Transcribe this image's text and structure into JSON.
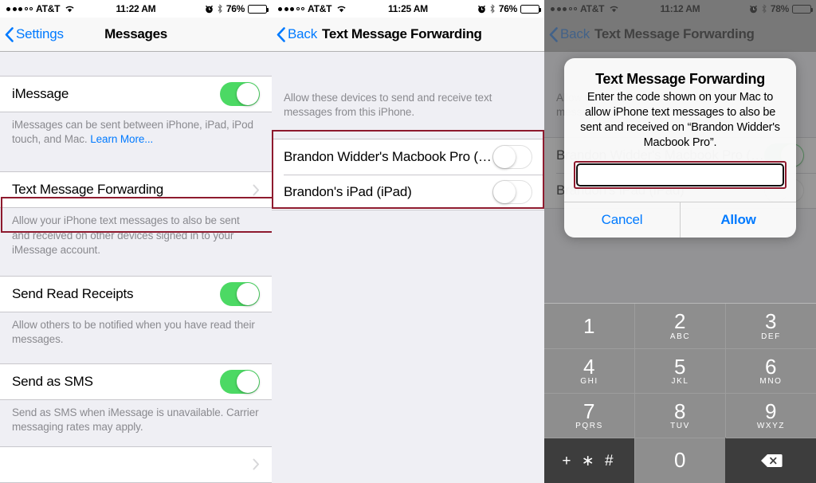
{
  "panels": [
    {
      "id": "messages-settings",
      "statusbar": {
        "carrier": "AT&T",
        "time": "11:22 AM",
        "battery_pct": "76%",
        "signal_filled": 3,
        "signal_hollow": 2,
        "icons": [
          "alarm-icon",
          "bluetooth-icon",
          "battery-icon",
          "wifi-icon"
        ]
      },
      "nav": {
        "back_label": "Settings",
        "title": "Messages"
      },
      "rows": [
        {
          "label": "iMessage",
          "type": "toggle",
          "state": "on"
        }
      ],
      "footnote_imessage": "iMessages can be sent between iPhone, iPad, iPod touch, and Mac. ",
      "footnote_link": "Learn More...",
      "forwarding_row": {
        "label": "Text Message Forwarding",
        "type": "disclosure"
      },
      "footnote_forwarding": "Allow your iPhone text messages to also be sent and received on other devices signed in to your iMessage account.",
      "read_receipts_row": {
        "label": "Send Read Receipts",
        "type": "toggle",
        "state": "on"
      },
      "footnote_read_receipts": "Allow others to be notified when you have read their messages.",
      "send_sms_row": {
        "label": "Send as SMS",
        "type": "toggle",
        "state": "on"
      },
      "footnote_send_sms": "Send as SMS when iMessage is unavailable. Carrier messaging rates may apply."
    },
    {
      "id": "forwarding-devices",
      "statusbar": {
        "carrier": "AT&T",
        "time": "11:25 AM",
        "battery_pct": "76%",
        "signal_filled": 3,
        "signal_hollow": 2
      },
      "nav": {
        "back_label": "Back",
        "title": "Text Message Forwarding"
      },
      "footnote_top": "Allow these devices to send and receive text messages from this iPhone.",
      "devices": [
        {
          "label": "Brandon Widder's Macbook Pro (…",
          "state": "off"
        },
        {
          "label": "Brandon's iPad (iPad)",
          "state": "off"
        }
      ]
    },
    {
      "id": "forwarding-code-dialog",
      "statusbar": {
        "carrier": "AT&T",
        "time": "11:12 AM",
        "battery_pct": "78%",
        "signal_filled": 3,
        "signal_hollow": 2
      },
      "nav": {
        "back_label": "Back",
        "title": "Text Message Forwarding"
      },
      "bg_footnote": "Allow these devices to send and receive text messages from this iPhone.",
      "bg_devices": [
        {
          "label": "Brandon Widder's Macbook Pro (…",
          "state": "on"
        },
        {
          "label": "Brandon's iPad (iPad)",
          "state": "off"
        }
      ],
      "alert": {
        "title": "Text Message Forwarding",
        "message": "Enter the code shown on your Mac to allow iPhone text messages to also be sent and received on “Brandon Widder's Macbook Pro”.",
        "input_value": "",
        "input_placeholder": "",
        "cancel_label": "Cancel",
        "allow_label": "Allow"
      },
      "keypad": {
        "rows": [
          [
            {
              "num": "1",
              "letters": ""
            },
            {
              "num": "2",
              "letters": "ABC"
            },
            {
              "num": "3",
              "letters": "DEF"
            }
          ],
          [
            {
              "num": "4",
              "letters": "GHI"
            },
            {
              "num": "5",
              "letters": "JKL"
            },
            {
              "num": "6",
              "letters": "MNO"
            }
          ],
          [
            {
              "num": "7",
              "letters": "PQRS"
            },
            {
              "num": "8",
              "letters": "TUV"
            },
            {
              "num": "9",
              "letters": "WXYZ"
            }
          ]
        ],
        "symbols_key": "+ ∗ #",
        "zero_key": "0",
        "backspace_icon": "backspace-icon"
      }
    }
  ],
  "colors": {
    "accent_blue": "#007aff",
    "toggle_green": "#4cd964",
    "annotation_red": "#8e1a2e",
    "group_bg": "#efeff4",
    "keypad_gray": "#8e8e8e",
    "keypad_dark": "#3d3d3d"
  }
}
